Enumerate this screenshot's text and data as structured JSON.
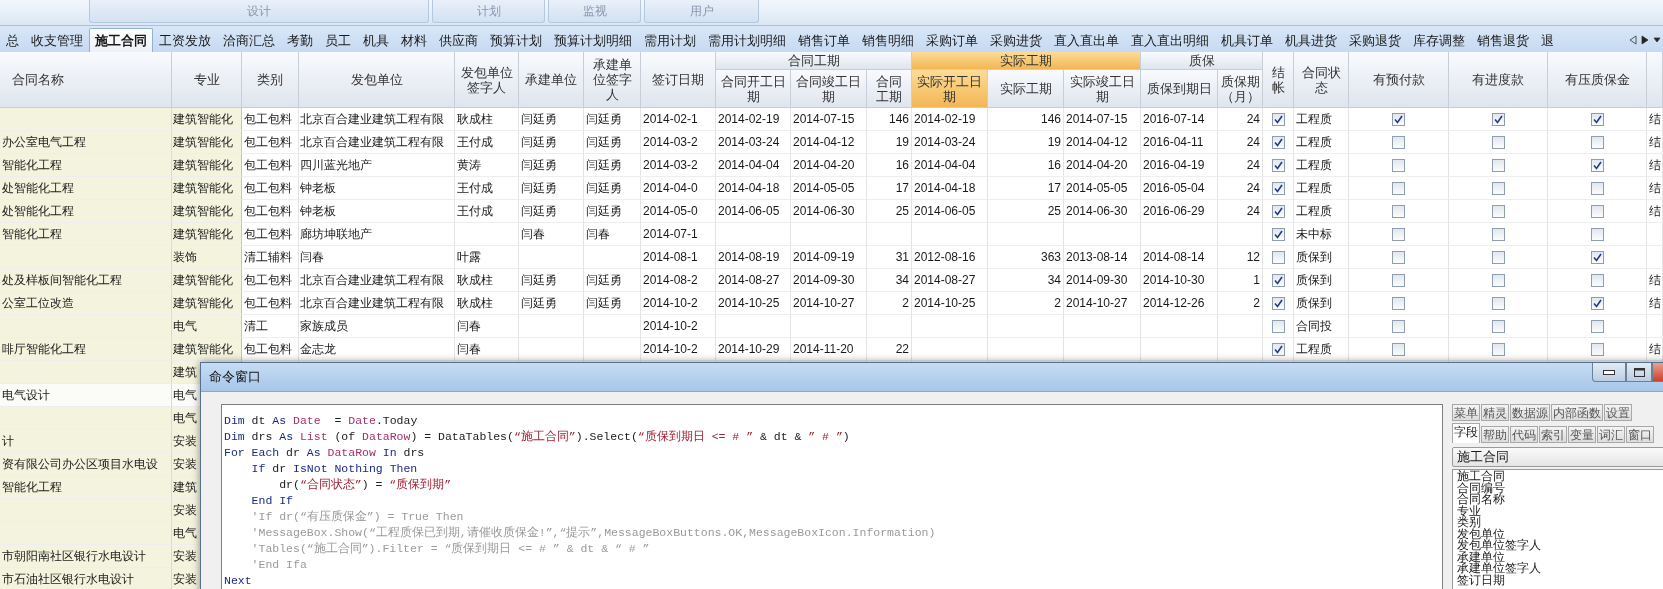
{
  "ribbon_groups": [
    {
      "label": "设计"
    },
    {
      "label": "计划"
    },
    {
      "label": "监视"
    },
    {
      "label": "用户"
    }
  ],
  "tabs": [
    {
      "label": "总",
      "selected": false
    },
    {
      "label": "收支管理",
      "selected": false
    },
    {
      "label": "施工合同",
      "selected": true
    },
    {
      "label": "工资发放",
      "selected": false
    },
    {
      "label": "洽商汇总",
      "selected": false
    },
    {
      "label": "考勤",
      "selected": false
    },
    {
      "label": "员工",
      "selected": false
    },
    {
      "label": "机具",
      "selected": false
    },
    {
      "label": "材料",
      "selected": false
    },
    {
      "label": "供应商",
      "selected": false
    },
    {
      "label": "预算计划",
      "selected": false
    },
    {
      "label": "预算计划明细",
      "selected": false
    },
    {
      "label": "需用计划",
      "selected": false
    },
    {
      "label": "需用计划明细",
      "selected": false
    },
    {
      "label": "销售订单",
      "selected": false
    },
    {
      "label": "销售明细",
      "selected": false
    },
    {
      "label": "采购订单",
      "selected": false
    },
    {
      "label": "采购进货",
      "selected": false
    },
    {
      "label": "直入直出单",
      "selected": false
    },
    {
      "label": "直入直出明细",
      "selected": false
    },
    {
      "label": "机具订单",
      "selected": false
    },
    {
      "label": "机具进货",
      "selected": false
    },
    {
      "label": "采购退货",
      "selected": false
    },
    {
      "label": "库存调整",
      "selected": false
    },
    {
      "label": "销售退货",
      "selected": false
    },
    {
      "label": "退",
      "selected": false
    }
  ],
  "table": {
    "columns": [
      {
        "label": "合同名称",
        "kind": "text",
        "highlighted": false,
        "grouped": false
      },
      {
        "label": "专业",
        "kind": "text",
        "highlighted": false,
        "grouped": false
      },
      {
        "label": "类别",
        "kind": "text",
        "highlighted": false,
        "grouped": false
      },
      {
        "label": "发包单位",
        "kind": "text",
        "highlighted": false,
        "grouped": false
      },
      {
        "label": "发包单位签字人",
        "kind": "text",
        "highlighted": false,
        "grouped": false
      },
      {
        "label": "承建单位",
        "kind": "text",
        "highlighted": false,
        "grouped": false
      },
      {
        "label": "承建单位签字人",
        "kind": "text",
        "highlighted": false,
        "grouped": false
      },
      {
        "label": "签订日期",
        "kind": "text",
        "highlighted": false,
        "grouped": false
      },
      {
        "label": "合同开工日期",
        "kind": "text",
        "highlighted": false,
        "grouped": true,
        "group": {
          "label": "合同工期",
          "highlighted": false
        }
      },
      {
        "label": "合同竣工日期",
        "kind": "text",
        "highlighted": false,
        "grouped": true
      },
      {
        "label": "合同工期",
        "kind": "number",
        "highlighted": false,
        "grouped": true
      },
      {
        "label": "实际开工日期",
        "kind": "text",
        "highlighted": true,
        "grouped": true,
        "group": {
          "label": "实际工期",
          "highlighted": true
        }
      },
      {
        "label": "实际工期",
        "kind": "number",
        "highlighted": false,
        "grouped": true
      },
      {
        "label": "实际竣工日期",
        "kind": "text",
        "highlighted": false,
        "grouped": true
      },
      {
        "label": "质保到期日",
        "kind": "text",
        "highlighted": false,
        "grouped": true,
        "group": {
          "label": "质保",
          "highlighted": false
        }
      },
      {
        "label": "质保期（月）",
        "kind": "number",
        "highlighted": false,
        "grouped": true
      },
      {
        "label": "结帐",
        "kind": "check",
        "highlighted": false,
        "grouped": false
      },
      {
        "label": "合同状态",
        "kind": "text",
        "highlighted": false,
        "grouped": false
      },
      {
        "label": "有预付款",
        "kind": "check",
        "highlighted": false,
        "grouped": false
      },
      {
        "label": "有进度款",
        "kind": "check",
        "highlighted": false,
        "grouped": false
      },
      {
        "label": "有压质保金",
        "kind": "check",
        "highlighted": false,
        "grouped": false
      },
      {
        "kind": "text",
        "highlighted": false,
        "grouped": false
      }
    ],
    "rows": [
      {
        "selected": false,
        "cells": [
          null,
          "建筑智能化",
          "包工包料",
          "北京百合建业建筑工程有限",
          "耿成柱",
          "闫廷勇",
          "闫廷勇",
          "2014-02-1",
          "2014-02-19",
          "2014-07-15",
          "146",
          "2014-02-19",
          "146",
          "2014-07-15",
          "2016-07-14",
          "24",
          true,
          "工程质",
          true,
          true,
          true,
          "结"
        ]
      },
      {
        "selected": false,
        "cells": [
          "办公室电气工程",
          "建筑智能化",
          "包工包料",
          "北京百合建业建筑工程有限",
          "王付成",
          "闫廷勇",
          "闫廷勇",
          "2014-03-2",
          "2014-03-24",
          "2014-04-12",
          "19",
          "2014-03-24",
          "19",
          "2014-04-12",
          "2016-04-11",
          "24",
          true,
          "工程质",
          false,
          false,
          false,
          "结"
        ]
      },
      {
        "selected": false,
        "cells": [
          "智能化工程",
          "建筑智能化",
          "包工包料",
          "四川蓝光地产",
          "黄涛",
          "闫廷勇",
          "闫廷勇",
          "2014-03-2",
          "2014-04-04",
          "2014-04-20",
          "16",
          "2014-04-04",
          "16",
          "2014-04-20",
          "2016-04-19",
          "24",
          true,
          "工程质",
          false,
          false,
          true,
          "结"
        ]
      },
      {
        "selected": false,
        "cells": [
          "处智能化工程",
          "建筑智能化",
          "包工包料",
          "钟老板",
          "王付成",
          "闫廷勇",
          "闫廷勇",
          "2014-04-0",
          "2014-04-18",
          "2014-05-05",
          "17",
          "2014-04-18",
          "17",
          "2014-05-05",
          "2016-05-04",
          "24",
          true,
          "工程质",
          false,
          false,
          false,
          "结"
        ]
      },
      {
        "selected": false,
        "cells": [
          "处智能化工程",
          "建筑智能化",
          "包工包料",
          "钟老板",
          "王付成",
          "闫廷勇",
          "闫廷勇",
          "2014-05-0",
          "2014-06-05",
          "2014-06-30",
          "25",
          "2014-06-05",
          "25",
          "2014-06-30",
          "2016-06-29",
          "24",
          true,
          "工程质",
          false,
          false,
          false,
          "结"
        ]
      },
      {
        "selected": false,
        "cells": [
          "智能化工程",
          "建筑智能化",
          "包工包料",
          "廊坊坤联地产",
          null,
          "闫春",
          "闫春",
          "2014-07-1",
          null,
          null,
          null,
          null,
          null,
          null,
          null,
          null,
          true,
          "未中标",
          false,
          false,
          false,
          null
        ]
      },
      {
        "selected": false,
        "cells": [
          null,
          "装饰",
          "清工辅料",
          "闫春",
          "叶露",
          null,
          null,
          "2014-08-1",
          "2014-08-19",
          "2014-09-19",
          "31",
          "2012-08-16",
          "363",
          "2013-08-14",
          "2014-08-14",
          "12",
          false,
          "质保到",
          false,
          false,
          true,
          null
        ]
      },
      {
        "selected": false,
        "cells": [
          "处及样板间智能化工程",
          "建筑智能化",
          "包工包料",
          "北京百合建业建筑工程有限",
          "耿成柱",
          "闫廷勇",
          "闫廷勇",
          "2014-08-2",
          "2014-08-27",
          "2014-09-30",
          "34",
          "2014-08-27",
          "34",
          "2014-09-30",
          "2014-10-30",
          "1",
          true,
          "质保到",
          false,
          false,
          false,
          "结"
        ]
      },
      {
        "selected": false,
        "cells": [
          "公室工位改造",
          "建筑智能化",
          "包工包料",
          "北京百合建业建筑工程有限",
          "耿成柱",
          "闫廷勇",
          "闫廷勇",
          "2014-10-2",
          "2014-10-25",
          "2014-10-27",
          "2",
          "2014-10-25",
          "2",
          "2014-10-27",
          "2014-12-26",
          "2",
          true,
          "质保到",
          false,
          false,
          true,
          "结"
        ]
      },
      {
        "selected": false,
        "cells": [
          null,
          "电气",
          "清工",
          "家族成员",
          "闫春",
          null,
          null,
          "2014-10-2",
          null,
          null,
          null,
          null,
          null,
          null,
          null,
          null,
          false,
          "合同投",
          false,
          false,
          false,
          null
        ]
      },
      {
        "selected": false,
        "cells": [
          "啡厅智能化工程",
          "建筑智能化",
          "包工包料",
          "金志龙",
          "闫春",
          null,
          null,
          "2014-10-2",
          "2014-10-29",
          "2014-11-20",
          "22",
          null,
          null,
          null,
          null,
          null,
          true,
          "工程质",
          false,
          false,
          false,
          "结"
        ]
      },
      {
        "selected": false,
        "cells": [
          null,
          "建筑"
        ]
      },
      {
        "selected": true,
        "cells": [
          "电气设计",
          "电气"
        ]
      },
      {
        "selected": false,
        "cells": [
          null,
          "电气"
        ]
      },
      {
        "selected": false,
        "cells": [
          "计",
          "安装"
        ]
      },
      {
        "selected": false,
        "cells": [
          "资有限公司办公区项目水电设",
          "安装"
        ]
      },
      {
        "selected": false,
        "cells": [
          "智能化工程",
          "建筑"
        ]
      },
      {
        "selected": false,
        "cells": [
          null,
          "安装"
        ]
      },
      {
        "selected": false,
        "cells": [
          null,
          "电气"
        ]
      },
      {
        "selected": false,
        "cells": [
          "市朝阳南社区银行水电设计",
          "安装"
        ]
      },
      {
        "selected": false,
        "cells": [
          "市石油社区银行水电设计",
          "安装"
        ]
      }
    ]
  },
  "command_window": {
    "title": "命令窗口",
    "code_lines": [
      {
        "tokens": [
          {
            "text": "Dim",
            "kind": "keyword"
          },
          {
            "text": " dt ",
            "kind": "plain"
          },
          {
            "text": "As ",
            "kind": "keyword"
          },
          {
            "text": "Date",
            "kind": "type"
          },
          {
            "text": "  = ",
            "kind": "plain"
          },
          {
            "text": "Date",
            "kind": "type"
          },
          {
            "text": ".Today",
            "kind": "plain"
          }
        ]
      },
      {
        "tokens": [
          {
            "text": "Dim",
            "kind": "keyword"
          },
          {
            "text": " drs ",
            "kind": "plain"
          },
          {
            "text": "As ",
            "kind": "keyword"
          },
          {
            "text": "List",
            "kind": "type"
          },
          {
            "text": " (of ",
            "kind": "plain"
          },
          {
            "text": "DataRow",
            "kind": "type"
          },
          {
            "text": ") = DataTables(",
            "kind": "plain"
          },
          {
            "text": "“施工合同”",
            "kind": "string"
          },
          {
            "text": ").Select(",
            "kind": "plain"
          },
          {
            "text": "“质保到期日 <= # ”",
            "kind": "string"
          },
          {
            "text": " & dt & ",
            "kind": "plain"
          },
          {
            "text": "” # ”",
            "kind": "string"
          },
          {
            "text": ")",
            "kind": "plain"
          }
        ]
      },
      {
        "tokens": [
          {
            "text": "For Each",
            "kind": "keyword"
          },
          {
            "text": " dr ",
            "kind": "plain"
          },
          {
            "text": "As ",
            "kind": "keyword"
          },
          {
            "text": "DataRow",
            "kind": "type"
          },
          {
            "text": " In",
            "kind": "keyword"
          },
          {
            "text": " drs",
            "kind": "plain"
          }
        ]
      },
      {
        "tokens": [
          {
            "text": "    If",
            "kind": "keyword"
          },
          {
            "text": " dr ",
            "kind": "plain"
          },
          {
            "text": "IsNot Nothing Then",
            "kind": "keyword"
          }
        ]
      },
      {
        "tokens": [
          {
            "text": "        dr(",
            "kind": "plain"
          },
          {
            "text": "“合同状态”",
            "kind": "string"
          },
          {
            "text": ") = ",
            "kind": "plain"
          },
          {
            "text": "“质保到期”",
            "kind": "string"
          }
        ]
      },
      {
        "tokens": [
          {
            "text": "    End If",
            "kind": "keyword"
          }
        ]
      },
      {
        "tokens": [
          {
            "text": "    'If dr(“有压质保金”) = True Then",
            "kind": "comment"
          }
        ]
      },
      {
        "tokens": [
          {
            "text": "    'MessageBox.Show(“工程质保已到期,请催收质保金!”,“提示”,MessageBoxButtons.OK,MessageBoxIcon.Information)",
            "kind": "comment"
          }
        ]
      },
      {
        "tokens": [
          {
            "text": "    'Tables(“施工合同”).Filter = “质保到期日 <= # ” & dt & “ # ”",
            "kind": "comment"
          }
        ]
      },
      {
        "tokens": [
          {
            "text": "    'End Ifa",
            "kind": "comment"
          }
        ]
      },
      {
        "tokens": [
          {
            "text": "Next",
            "kind": "keyword"
          }
        ]
      }
    ],
    "side_tabs_top": [
      {
        "label": "菜单",
        "selected": false
      },
      {
        "label": "精灵",
        "selected": false
      },
      {
        "label": "数据源",
        "selected": false
      },
      {
        "label": "内部函数",
        "selected": false
      },
      {
        "label": "设置",
        "selected": false
      }
    ],
    "side_tabs_bottom": [
      {
        "label": "字段",
        "selected": true
      },
      {
        "label": "帮助",
        "selected": false
      },
      {
        "label": "代码",
        "selected": false
      },
      {
        "label": "索引",
        "selected": false
      },
      {
        "label": "变量",
        "selected": false
      },
      {
        "label": "词汇",
        "selected": false
      },
      {
        "label": "窗口",
        "selected": false
      }
    ],
    "table_select": {
      "value": "施工合同"
    },
    "field_list": [
      "施工合同",
      "合同编号",
      "合同名称",
      "专业",
      "类别",
      "发包单位",
      "发包单位签字人",
      "承建单位",
      "承建单位签字人",
      "签订日期"
    ]
  }
}
